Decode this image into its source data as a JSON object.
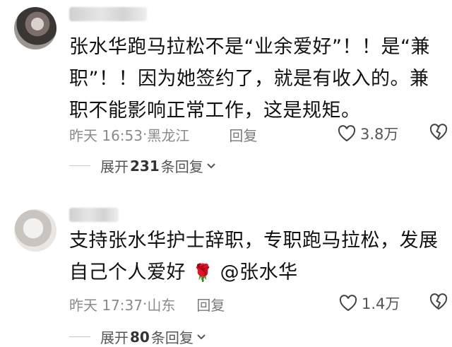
{
  "comments": [
    {
      "text": "张水华跑马拉松不是“业余爱好”！！是“兼职”！！因为她签约了，就是有收入的。兼职不能影响正常工作，这是规矩。",
      "time": "昨天 16:53",
      "location": "黑龙江",
      "reply_label": "回复",
      "likes": "3.8万",
      "expand_prefix": "展开",
      "expand_count": "231",
      "expand_suffix": "条回复"
    },
    {
      "text": "支持张水华护士辞职，专职跑马拉松，发展自己个人爱好",
      "emoji": "🌹",
      "mention": "@张水华",
      "time": "昨天 17:37",
      "location": "山东",
      "reply_label": "回复",
      "likes": "1.4万",
      "expand_prefix": "展开",
      "expand_count": "80",
      "expand_suffix": "条回复"
    }
  ],
  "meta_separator": "·",
  "icons": {
    "like": "heart-outline-icon",
    "dislike": "broken-heart-icon",
    "expand": "chevron-down-icon"
  }
}
